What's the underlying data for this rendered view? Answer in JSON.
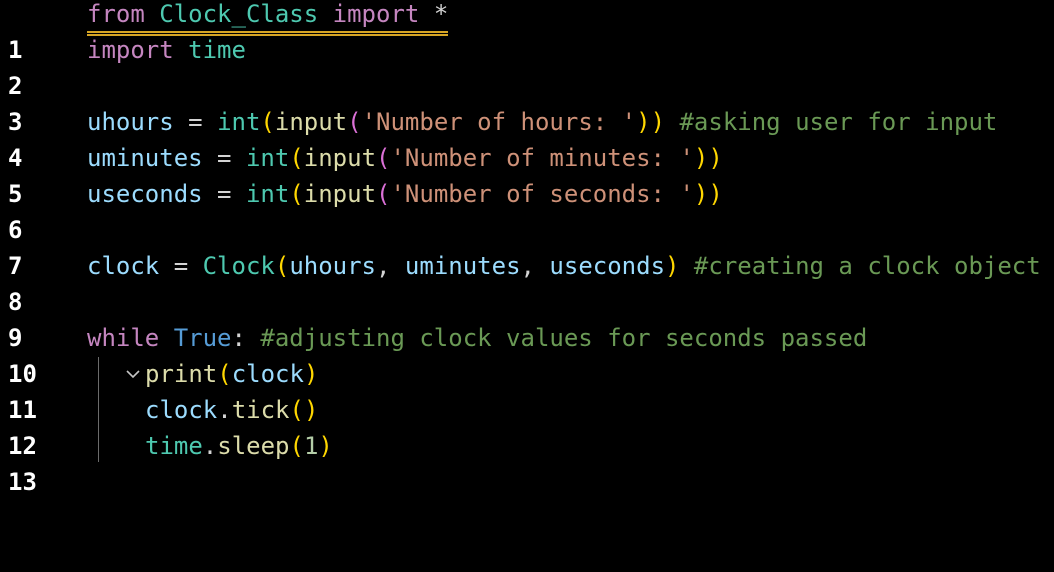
{
  "editor": {
    "lines": [
      {
        "number": "1",
        "tokens": {
          "t1": "from",
          "t2": "Clock_Class",
          "t3": "import",
          "t4": "*"
        }
      },
      {
        "number": "2",
        "tokens": {
          "t1": "import",
          "t2": "time"
        }
      },
      {
        "number": "3"
      },
      {
        "number": "4",
        "tokens": {
          "t1": "uhours",
          "t2": "=",
          "t3": "int",
          "t4": "(",
          "t5": "input",
          "t6": "(",
          "t7": "'Number of hours: '",
          "t8": "))",
          "t9": "#asking user for input"
        }
      },
      {
        "number": "5",
        "tokens": {
          "t1": "uminutes",
          "t2": "=",
          "t3": "int",
          "t4": "(",
          "t5": "input",
          "t6": "(",
          "t7": "'Number of minutes: '",
          "t8": "))"
        }
      },
      {
        "number": "6",
        "tokens": {
          "t1": "useconds",
          "t2": "=",
          "t3": "int",
          "t4": "(",
          "t5": "input",
          "t6": "(",
          "t7": "'Number of seconds: '",
          "t8": "))"
        }
      },
      {
        "number": "7"
      },
      {
        "number": "8",
        "tokens": {
          "t1": "clock",
          "t2": "=",
          "t3": "Clock",
          "t4": "(",
          "t5": "uhours",
          "t6": ",",
          "t7": "uminutes",
          "t8": ",",
          "t9": "useconds",
          "t10": ")",
          "t11": "#creating a clock object"
        }
      },
      {
        "number": "9"
      },
      {
        "number": "10",
        "fold_icon": "chevron-down-icon",
        "tokens": {
          "t1": "while",
          "t2": "True",
          "t3": ":",
          "t4": "#adjusting clock values for seconds passed"
        }
      },
      {
        "number": "11",
        "tokens": {
          "t1": "print",
          "t2": "(",
          "t3": "clock",
          "t4": ")"
        }
      },
      {
        "number": "12",
        "tokens": {
          "t1": "clock",
          "t2": ".",
          "t3": "tick",
          "t4": "()"
        }
      },
      {
        "number": "13",
        "tokens": {
          "t1": "time",
          "t2": ".",
          "t3": "sleep",
          "t4": "(",
          "t5": "1",
          "t6": ")"
        }
      }
    ]
  },
  "colors": {
    "background": "#000000",
    "keyword": "#c586c0",
    "module": "#4ec9b0",
    "variable": "#9cdcfe",
    "function": "#dcdcaa",
    "string": "#ce9178",
    "comment": "#6a9955",
    "boolean": "#569cd6",
    "number": "#b5cea8",
    "warning_underline": "#d6a525"
  }
}
